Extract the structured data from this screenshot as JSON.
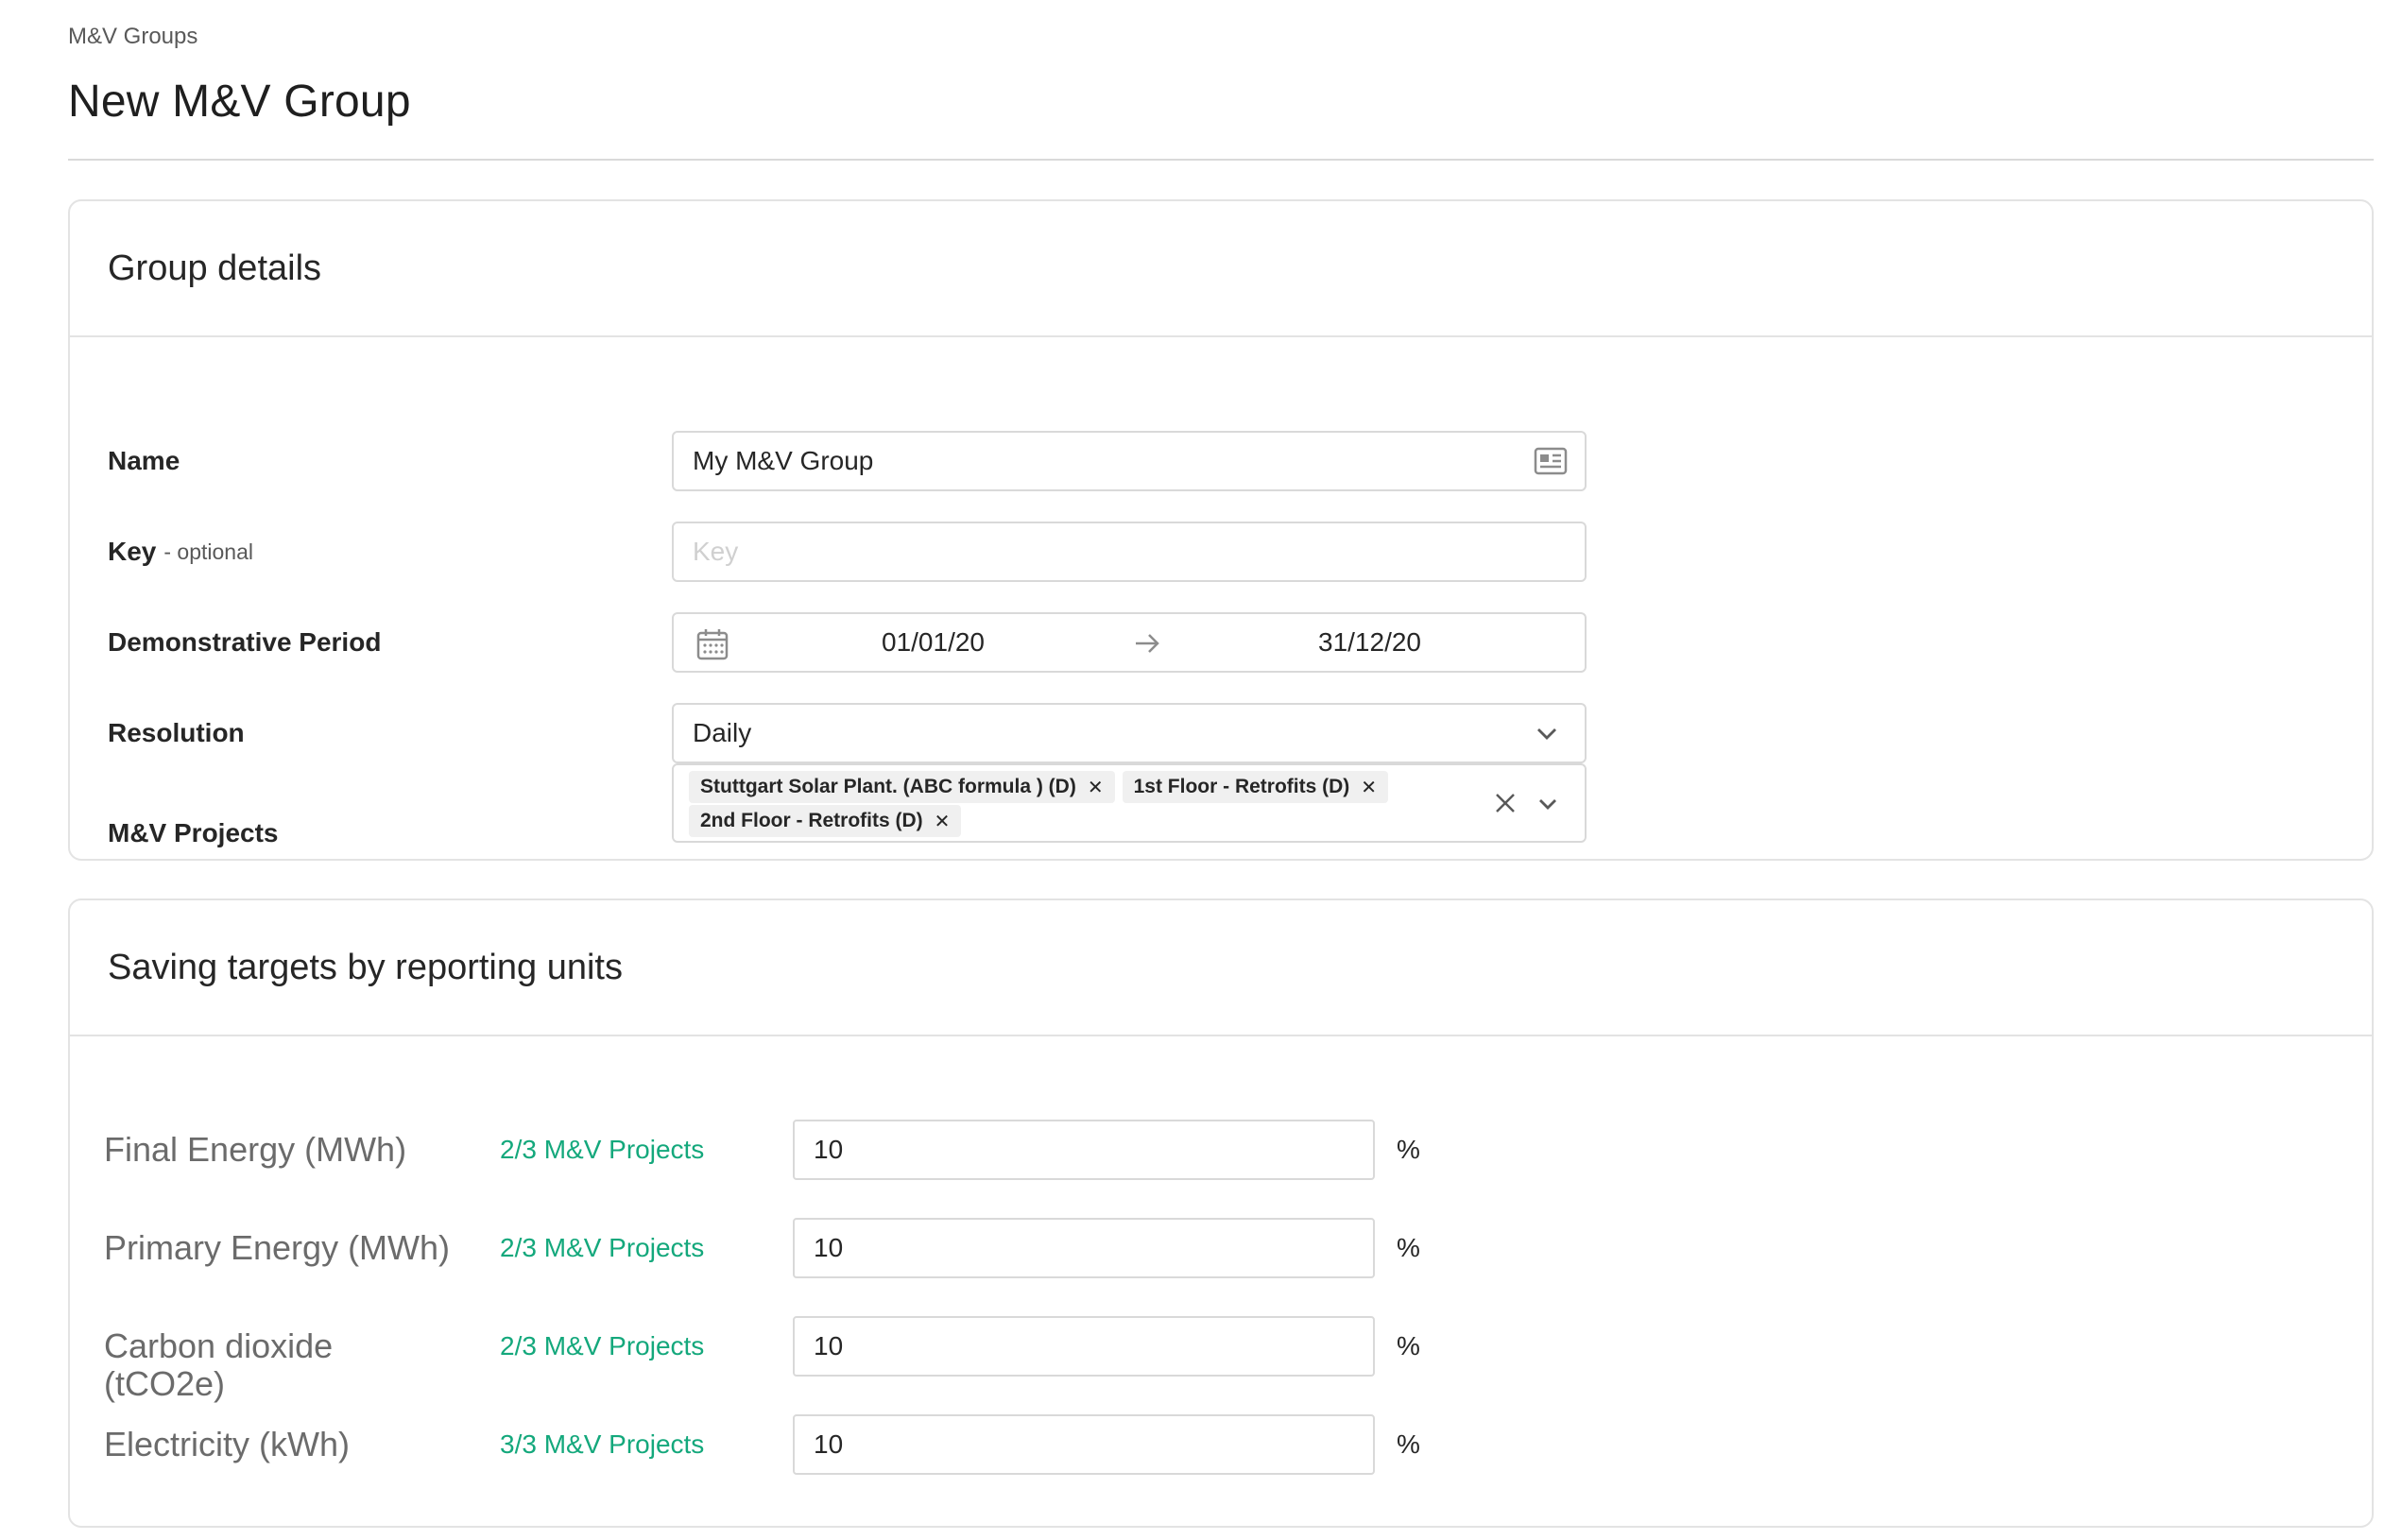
{
  "breadcrumb": "M&V Groups",
  "page_title": "New M&V Group",
  "group_details": {
    "title": "Group details",
    "name": {
      "label": "Name",
      "value": "My M&V Group"
    },
    "key": {
      "label": "Key",
      "optional": "- optional",
      "placeholder": "Key",
      "value": ""
    },
    "period": {
      "label": "Demonstrative Period",
      "start": "01/01/20",
      "end": "31/12/20"
    },
    "resolution": {
      "label": "Resolution",
      "value": "Daily"
    },
    "projects": {
      "label": "M&V Projects",
      "tags": [
        "Stuttgart Solar Plant. (ABC formula ) (D)",
        "1st Floor - Retrofits (D)",
        "2nd Floor - Retrofits (D)"
      ]
    }
  },
  "saving_targets": {
    "title": "Saving targets by reporting units",
    "rows": [
      {
        "label": "Final Energy (MWh)",
        "count": "2/3 M&V Projects",
        "value": "10",
        "unit": "%"
      },
      {
        "label": "Primary Energy (MWh)",
        "count": "2/3 M&V Projects",
        "value": "10",
        "unit": "%"
      },
      {
        "label": "Carbon dioxide (tCO2e)",
        "count": "2/3 M&V Projects",
        "value": "10",
        "unit": "%"
      },
      {
        "label": "Electricity (kWh)",
        "count": "3/3 M&V Projects",
        "value": "10",
        "unit": "%"
      }
    ]
  },
  "colors": {
    "accent_green": "#14a87c",
    "border": "#d9d9d9",
    "text": "#262626"
  },
  "icons": {
    "name_field": "contact-card-icon",
    "period": "calendar-icon",
    "period_separator": "arrow-right-icon",
    "dropdown": "chevron-down-icon",
    "clear": "close-icon",
    "tag_remove": "close-icon"
  }
}
